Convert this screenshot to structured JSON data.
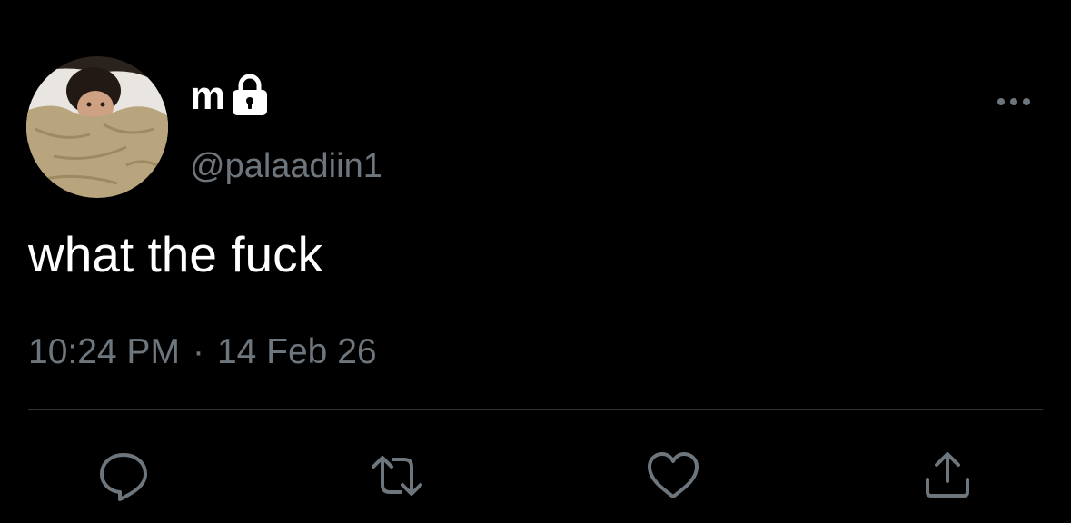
{
  "tweet": {
    "display_name": "m",
    "handle": "@palaadiin1",
    "text": "what the fuck",
    "time": "10:24 PM",
    "separator": "·",
    "date": "14 Feb 26"
  },
  "icons": {
    "verified_lock": "lock-icon",
    "more": "more-icon",
    "reply": "reply-icon",
    "retweet": "retweet-icon",
    "like": "heart-icon",
    "share": "share-icon"
  },
  "colors": {
    "background": "#000000",
    "primary_text": "#ffffff",
    "secondary_text": "#6e767d",
    "divider": "#2f3336",
    "icon": "#6e767d"
  }
}
